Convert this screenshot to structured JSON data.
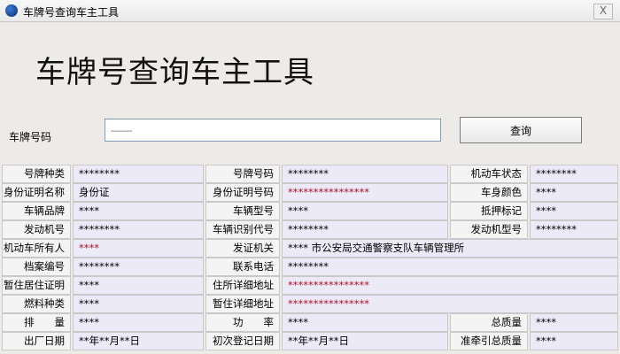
{
  "window": {
    "title": "车牌号查询车主工具",
    "close_label": "X"
  },
  "heading": "车牌号查询车主工具",
  "search": {
    "label": "车牌号码",
    "value": "",
    "placeholder": "——",
    "button_label": "查询"
  },
  "fields": [
    {
      "a": {
        "label": "号牌种类",
        "value": "********"
      },
      "b": {
        "label": "号牌号码",
        "value": "********"
      },
      "c": {
        "label": "机动车状态",
        "value": "********"
      }
    },
    {
      "a": {
        "label": "身份证明名称",
        "value": "身份证"
      },
      "b": {
        "label": "身份证明号码",
        "value": "****************",
        "red": true
      },
      "c": {
        "label": "车身颜色",
        "value": "****"
      }
    },
    {
      "a": {
        "label": "车辆品牌",
        "value": "****"
      },
      "b": {
        "label": "车辆型号",
        "value": "****"
      },
      "c": {
        "label": "抵押标记",
        "value": "****"
      }
    },
    {
      "a": {
        "label": "发动机号",
        "value": "********"
      },
      "b": {
        "label": "车辆识别代号",
        "value": "********"
      },
      "c": {
        "label": "发动机型号",
        "value": "********"
      }
    },
    {
      "a": {
        "label": "机动车所有人",
        "value": "****",
        "red": true
      },
      "b": {
        "label": "发证机关",
        "value": "**** 市公安局交通警察支队车辆管理所"
      }
    },
    {
      "a": {
        "label": "档案编号",
        "value": "********"
      },
      "b": {
        "label": "联系电话",
        "value": "********"
      }
    },
    {
      "a": {
        "label": "暂住居住证明",
        "value": "****"
      },
      "b": {
        "label": "住所详细地址",
        "value": "****************",
        "red": true
      }
    },
    {
      "a": {
        "label": "燃料种类",
        "value": "****"
      },
      "b": {
        "label": "暂住详细地址",
        "value": "****************",
        "red": true
      }
    },
    {
      "a": {
        "label": "排　　量",
        "value": "****"
      },
      "b": {
        "label": "功　　率",
        "value": "****"
      },
      "c": {
        "label": "总质量",
        "value": "****"
      }
    },
    {
      "a": {
        "label": "出厂日期",
        "value": "**年**月**日"
      },
      "b": {
        "label": "初次登记日期",
        "value": "**年**月**日"
      },
      "c": {
        "label": "准牵引总质量",
        "value": "****"
      }
    }
  ]
}
